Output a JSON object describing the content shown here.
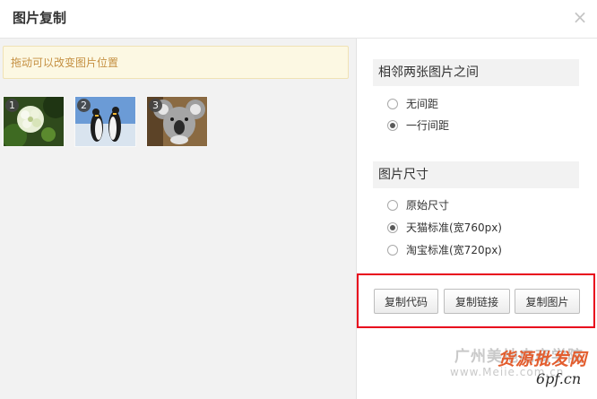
{
  "dialog": {
    "title": "图片复制",
    "close_icon": "close-icon"
  },
  "tip": {
    "text": "拖动可以改变图片位置"
  },
  "thumbnails": [
    {
      "number": "1",
      "subject": "flower"
    },
    {
      "number": "2",
      "subject": "penguins"
    },
    {
      "number": "3",
      "subject": "koala"
    }
  ],
  "spacing": {
    "title": "相邻两张图片之间",
    "options": [
      {
        "label": "无间距",
        "checked": false
      },
      {
        "label": "一行间距",
        "checked": true
      }
    ]
  },
  "size": {
    "title": "图片尺寸",
    "options": [
      {
        "label": "原始尺寸",
        "checked": false
      },
      {
        "label": "天猫标准(宽760px)",
        "checked": true
      },
      {
        "label": "淘宝标准(宽720px)",
        "checked": false
      }
    ]
  },
  "actions": {
    "copy_code": "复制代码",
    "copy_link": "复制链接",
    "copy_image": "复制图片"
  },
  "watermark": {
    "line1": "广州美地电商学院",
    "line2": "www.Meiie.com.cn",
    "red_text": "货源批发网",
    "site": "6pf.cn"
  },
  "colors": {
    "highlight_border": "#e8001c",
    "tip_bg": "#fcf8e3",
    "tip_text": "#c59042"
  }
}
